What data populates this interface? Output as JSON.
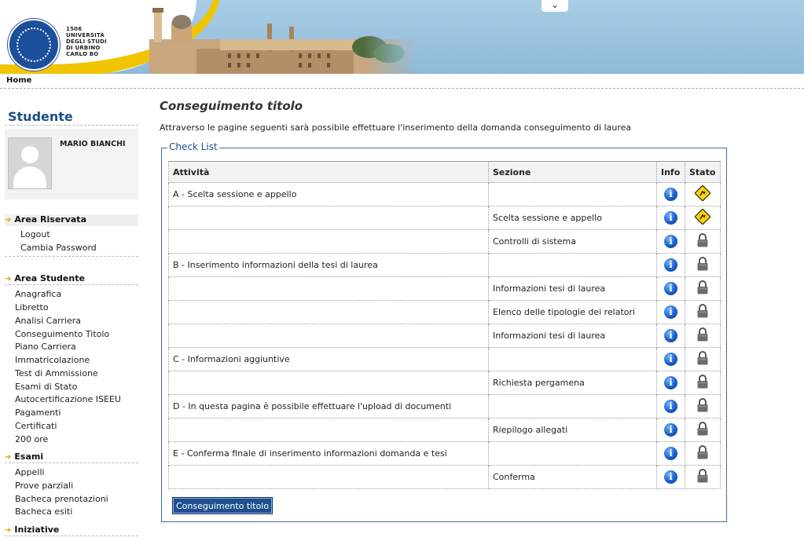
{
  "header": {
    "founded": "1506",
    "university_lines": [
      "UNIVERSITÀ",
      "DEGLI STUDI",
      "DI URBINO",
      "CARLO BO"
    ]
  },
  "topnav": {
    "home": "Home"
  },
  "sidebar": {
    "title": "Studente",
    "user_name": "MARIO BIANCHI",
    "area_riservata": {
      "title": "Area Riservata",
      "links": [
        "Logout",
        "Cambia Password"
      ]
    },
    "area_studente": {
      "title": "Area Studente",
      "links": [
        "Anagrafica",
        "Libretto",
        "Analisi Carriera",
        "Conseguimento Titolo",
        "Piano Carriera",
        "Immatricolazione",
        "Test di Ammissione",
        "Esami di Stato",
        "Autocertificazione ISEEU",
        "Pagamenti",
        "Certificati",
        "200 ore"
      ]
    },
    "esami": {
      "title": "Esami",
      "links": [
        "Appelli",
        "Prove parziali",
        "Bacheca prenotazioni",
        "Bacheca esiti"
      ]
    },
    "iniziative": {
      "title": "Iniziative"
    }
  },
  "main": {
    "title": "Conseguimento titolo",
    "intro": "Attraverso le pagine seguenti sarà possibile effettuare l'inserimento della domanda conseguimento di laurea",
    "checklist_legend": "Check List",
    "columns": [
      "Attività",
      "Sezione",
      "Info",
      "Stato"
    ],
    "rows": [
      {
        "attivita": "A - Scelta sessione e appello",
        "sezione": "",
        "stato": "warning"
      },
      {
        "attivita": "",
        "sezione": "Scelta sessione e appello",
        "stato": "warning"
      },
      {
        "attivita": "",
        "sezione": "Controlli di sistema",
        "stato": "locked"
      },
      {
        "attivita": "B - Inserimento informazioni della tesi di laurea",
        "sezione": "",
        "stato": "locked"
      },
      {
        "attivita": "",
        "sezione": "Informazioni tesi di laurea",
        "stato": "locked"
      },
      {
        "attivita": "",
        "sezione": "Elenco delle tipologie dei relatori",
        "stato": "locked"
      },
      {
        "attivita": "",
        "sezione": "Informazioni tesi di laurea",
        "stato": "locked"
      },
      {
        "attivita": "C - Informazioni aggiuntive",
        "sezione": "",
        "stato": "locked"
      },
      {
        "attivita": "",
        "sezione": "Richiesta pergamena",
        "stato": "locked"
      },
      {
        "attivita": "D - In questa pagina è possibile effettuare l'upload di documenti",
        "sezione": "",
        "stato": "locked"
      },
      {
        "attivita": "",
        "sezione": "Riepilogo allegati",
        "stato": "locked"
      },
      {
        "attivita": "E - Conferma finale di inserimento informazioni domanda e tesi",
        "sezione": "",
        "stato": "locked"
      },
      {
        "attivita": "",
        "sezione": "Conferma",
        "stato": "locked"
      }
    ],
    "submit_button": "Conseguimento titolo"
  },
  "colors": {
    "brand_blue": "#1c4f8a",
    "banner_sky": "#8fbad9",
    "accent_yellow": "#f0c400",
    "button_blue": "#1f4f8f"
  }
}
